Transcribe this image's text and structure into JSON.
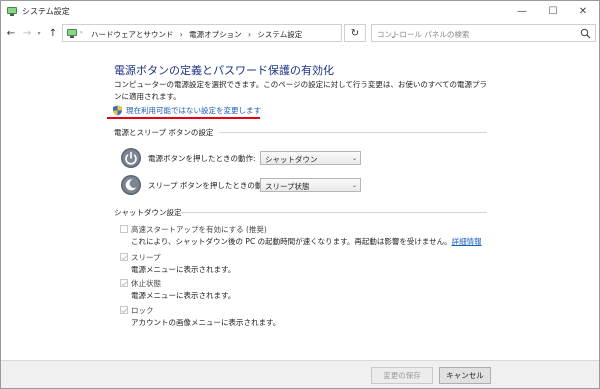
{
  "window": {
    "title": "システム設定",
    "minimize_glyph": "—",
    "maximize_glyph": "☐",
    "close_glyph": "✕"
  },
  "nav": {
    "back_glyph": "←",
    "forward_glyph": "→",
    "recent_glyph": "▾",
    "up_glyph": "↑",
    "breadcrumb_sep_glyph": "›",
    "breadcrumbs": [
      "ハードウェアとサウンド",
      "›",
      "電源オプション",
      "›",
      "システム設定"
    ],
    "address_dropdown_glyph": "⌄",
    "refresh_glyph": "↻",
    "search_placeholder": "コントロール パネルの検索"
  },
  "page": {
    "title": "電源ボタンの定義とパスワード保護の有効化",
    "description": "コンピューターの電源設定を選択できます。このページの設定に対して行う変更は、お使いのすべての電源プランに適用されます。",
    "uac_link": "現在利用可能ではない設定を変更します"
  },
  "power_section": {
    "title": "電源とスリープ ボタンの設定",
    "power_button_label": "電源ボタンを押したときの動作:",
    "power_button_value": "シャットダウン",
    "sleep_button_label": "スリープ ボタンを押したときの動作:",
    "sleep_button_value": "スリープ状態",
    "dropdown_glyph": "⌄"
  },
  "shutdown_section": {
    "title": "シャットダウン設定",
    "items": [
      {
        "label": "高速スタートアップを有効にする (推奨)",
        "description": "これにより、シャットダウン後の PC の起動時間が速くなります。再起動は影響を受けません。",
        "link": "詳細情報",
        "checked": false
      },
      {
        "label": "スリープ",
        "description": "電源メニューに表示されます。",
        "checked": true
      },
      {
        "label": "休止状態",
        "description": "電源メニューに表示されます。",
        "checked": true
      },
      {
        "label": "ロック",
        "description": "アカウントの画像メニューに表示されます。",
        "checked": true
      }
    ]
  },
  "footer": {
    "save_label": "変更の保存",
    "cancel_label": "キャンセル"
  },
  "colors": {
    "title_blue": "#1e3287",
    "link_blue": "#1a5fb4",
    "highlight_red": "#e60012"
  }
}
